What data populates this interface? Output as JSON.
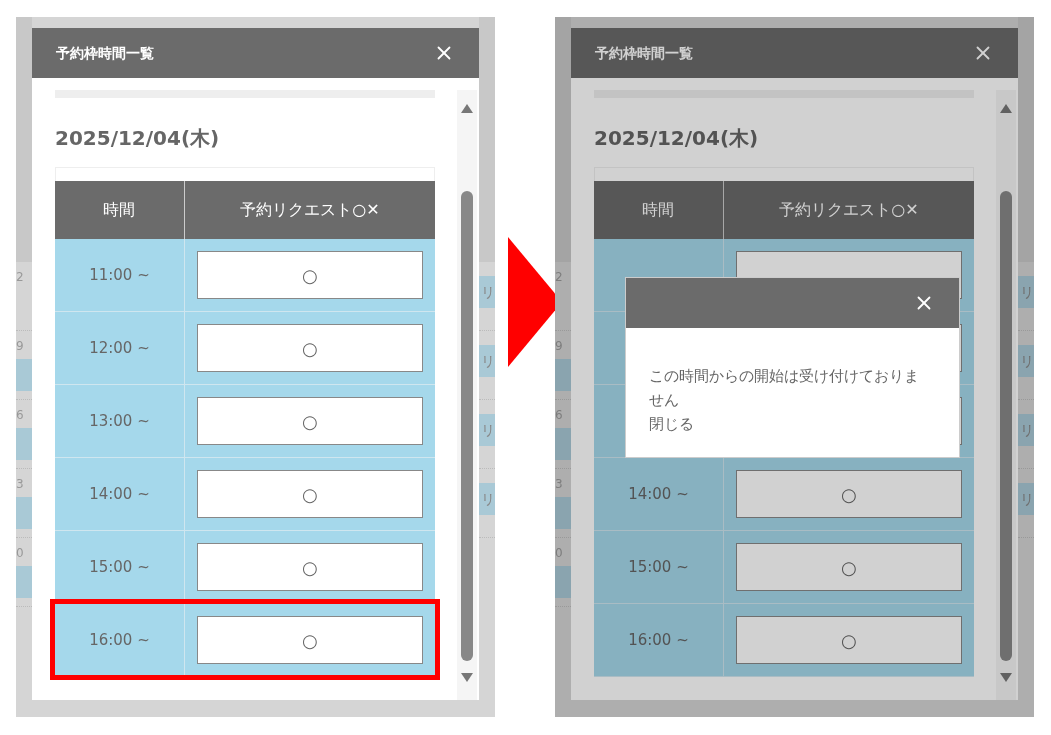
{
  "panels": [
    {
      "dimmed": false,
      "title": "予約枠時間一覧",
      "date": "2025/12/04(木)",
      "columns": [
        "時間",
        "予約リクエスト○✕"
      ],
      "rows": [
        {
          "time": "11:00 ~",
          "request": "○",
          "highlighted": false
        },
        {
          "time": "12:00 ~",
          "request": "○",
          "highlighted": false
        },
        {
          "time": "13:00 ~",
          "request": "○",
          "highlighted": false
        },
        {
          "time": "14:00 ~",
          "request": "○",
          "highlighted": false
        },
        {
          "time": "15:00 ~",
          "request": "○",
          "highlighted": false
        },
        {
          "time": "16:00 ~",
          "request": "○",
          "highlighted": true
        }
      ],
      "left_strip": [
        {
          "digit": "2",
          "chip": false
        },
        {
          "digit": "9",
          "chip": true
        },
        {
          "digit": "6",
          "chip": true
        },
        {
          "digit": "3",
          "chip": true
        },
        {
          "digit": "0",
          "chip": true
        }
      ],
      "right_strip": [
        {
          "chip": true,
          "chip_text": "リ"
        },
        {
          "chip": true,
          "chip_text": "リ"
        },
        {
          "chip": true,
          "chip_text": "リ"
        },
        {
          "chip": true,
          "chip_text": "リ"
        }
      ]
    },
    {
      "dimmed": true,
      "title": "予約枠時間一覧",
      "date": "2025/12/04(木)",
      "columns": [
        "時間",
        "予約リクエスト○✕"
      ],
      "rows": [
        {
          "highlighted": false
        },
        {
          "highlighted": false
        },
        {
          "highlighted": false
        },
        {
          "time": "14:00 ~",
          "request": "○",
          "highlighted": false
        },
        {
          "time": "15:00 ~",
          "request": "○",
          "highlighted": false
        },
        {
          "time": "16:00 ~",
          "request": "○",
          "highlighted": false
        }
      ],
      "left_strip": [
        {
          "digit": "2",
          "chip": false
        },
        {
          "digit": "9",
          "chip": true
        },
        {
          "digit": "6",
          "chip": true
        },
        {
          "digit": "3",
          "chip": true
        },
        {
          "digit": "0",
          "chip": true
        }
      ],
      "right_strip": [
        {
          "chip": true,
          "chip_text": "リ"
        },
        {
          "chip": true,
          "chip_text": "リ"
        },
        {
          "chip": true,
          "chip_text": "リ"
        },
        {
          "chip": true,
          "chip_text": "リ"
        }
      ],
      "dialog": {
        "message": "この時間からの開始は受け付けておりません",
        "link": "閉じる"
      }
    }
  ]
}
